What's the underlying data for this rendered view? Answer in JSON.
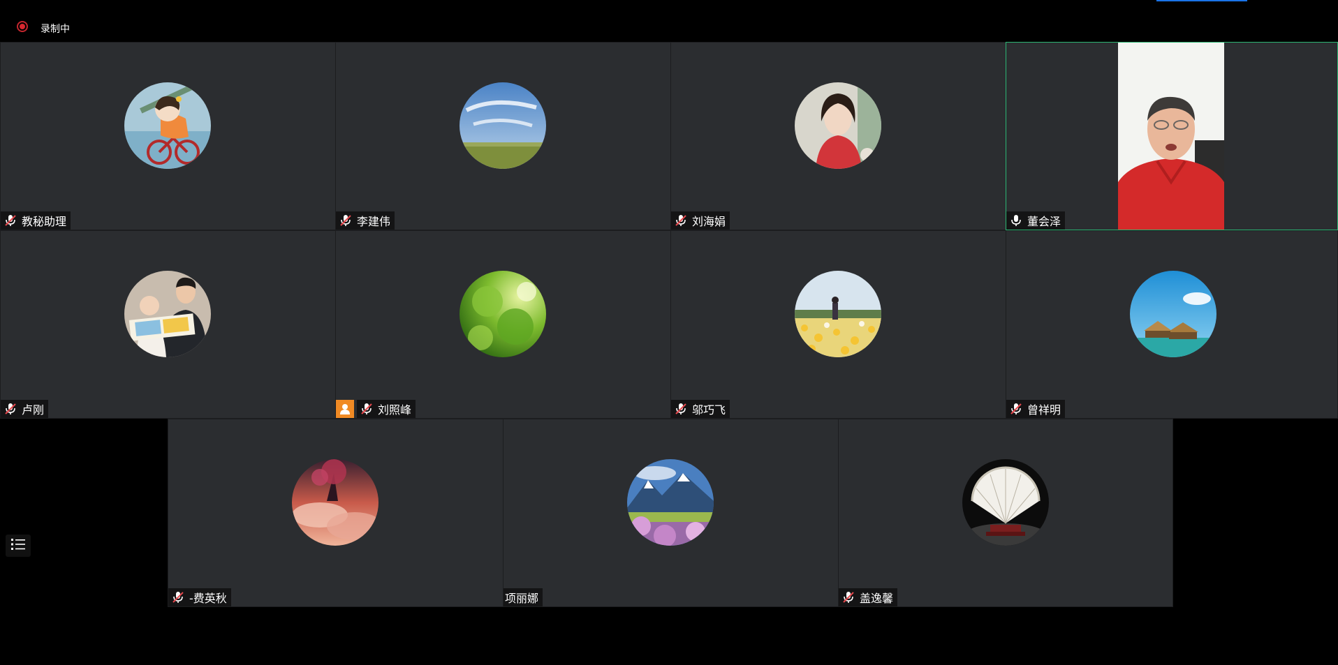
{
  "recording": {
    "status_label": "录制中",
    "indicator_icon": "record-dot-icon",
    "indicator_color": "#d9272f"
  },
  "toolbar": {
    "participant_list_icon": "list-icon"
  },
  "colors": {
    "tile_bg": "#2b2d30",
    "active_speaker_border": "#2bb673",
    "host_badge": "#f08a24"
  },
  "participants": [
    {
      "name": "教秘助理",
      "mic": "muted",
      "avatar": "cartoon-girl-bicycle"
    },
    {
      "name": "李建伟",
      "mic": "muted",
      "avatar": "blue-sky-grassland"
    },
    {
      "name": "刘海娟",
      "mic": "muted",
      "avatar": "woman-red-sweater-painting"
    },
    {
      "name": "董会泽",
      "mic": "on",
      "avatar": "live-video",
      "active": true
    },
    {
      "name": "卢刚",
      "mic": "muted",
      "avatar": "family-reading-book"
    },
    {
      "name": "刘照峰",
      "mic": "muted",
      "avatar": "green-leaves",
      "badge": "host-icon"
    },
    {
      "name": "邬巧飞",
      "mic": "muted",
      "avatar": "woman-in-flower-field"
    },
    {
      "name": "曾祥明",
      "mic": "muted",
      "avatar": "sky-seaside-huts"
    },
    {
      "name": "-费英秋",
      "mic": "muted",
      "avatar": "sunset-clouds-tree"
    },
    {
      "name": "项丽娜",
      "mic": "none",
      "avatar": "mountains-blossoms"
    },
    {
      "name": "盖逸馨",
      "mic": "muted",
      "avatar": "decorative-fan"
    }
  ]
}
